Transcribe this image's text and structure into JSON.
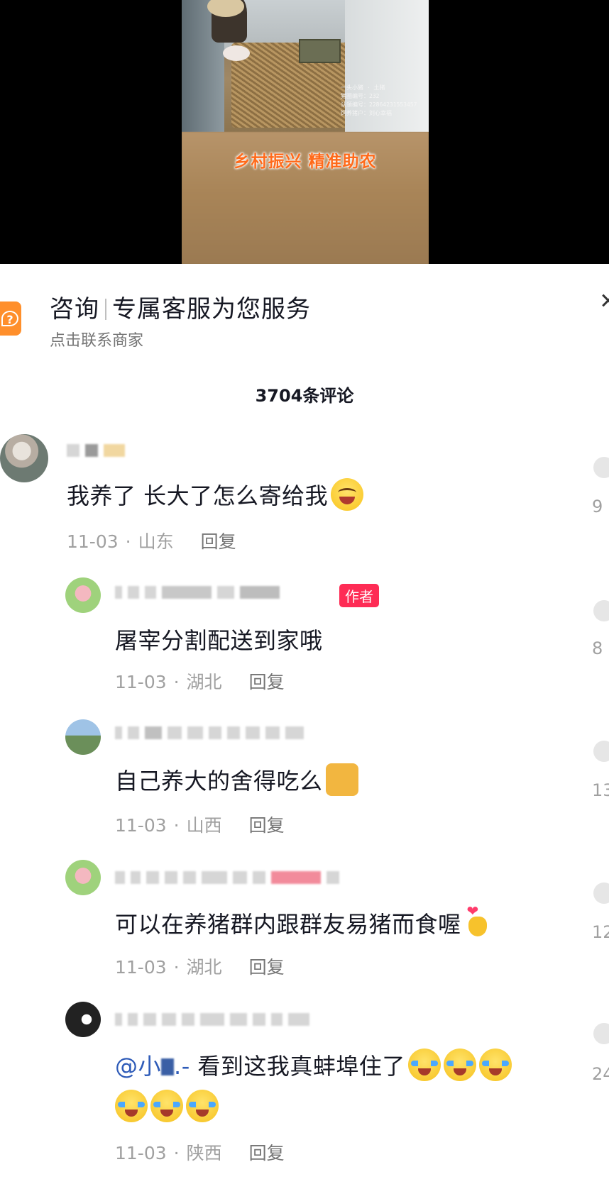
{
  "video": {
    "banner": "乡村振兴 精准助农",
    "overlay_lines": [
      "一头小猪 · 土猪",
      "猪圈编号：232",
      "认领编号：22864231553457",
      "饲养猪户：刘心幸福"
    ]
  },
  "consult": {
    "title": "咨询",
    "title_suffix": "专属客服为您服务",
    "subtitle": "点击联系商家",
    "icon": "question-icon"
  },
  "comments_header": {
    "count_label": "3704条评论"
  },
  "comments": [
    {
      "text": "我养了 长大了怎么寄给我",
      "emoji": "laugh",
      "date": "11-03",
      "location": "山东",
      "reply": "回复",
      "likes_partial": "9"
    },
    {
      "text": "屠宰分割配送到家哦",
      "author_tag": "作者",
      "date": "11-03",
      "location": "湖北",
      "reply": "回复",
      "likes_partial": "8"
    },
    {
      "text": "自己养大的舍得吃么",
      "emoji": "cat",
      "date": "11-03",
      "location": "山西",
      "reply": "回复",
      "likes_partial": "13"
    },
    {
      "text": "可以在养猪群内跟群友易猪而食喔",
      "emoji": "heart-hand",
      "date": "11-03",
      "location": "湖北",
      "reply": "回复",
      "likes_partial": "12"
    },
    {
      "mention": "@小",
      "mention_suffix": ".-",
      "text": " 看到这我真蚌埠住了",
      "emoji": "cry",
      "date": "11-03",
      "location": "陕西",
      "reply": "回复",
      "likes_partial": "24"
    }
  ],
  "colors": {
    "accent": "#fe2c55",
    "mention": "#2e5bb8",
    "banner": "#ff6a1a",
    "consult_icon": "#ff8f2b"
  }
}
